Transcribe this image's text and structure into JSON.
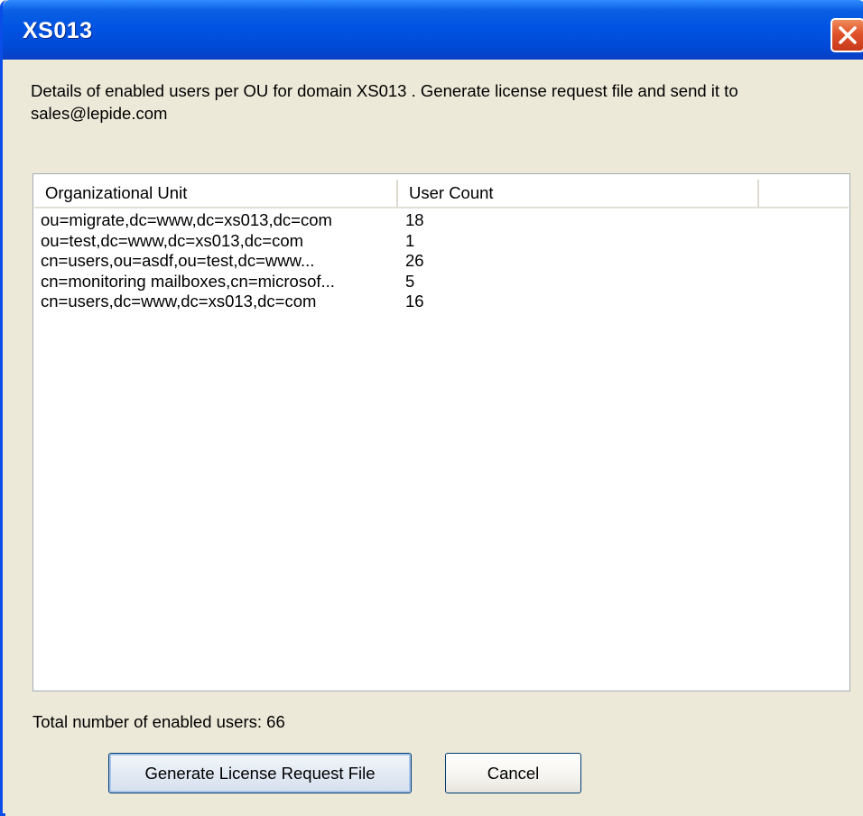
{
  "window": {
    "title": "XS013"
  },
  "description": "Details of enabled users per OU for domain XS013 . Generate license request file and send it to sales@lepide.com",
  "list": {
    "columns": [
      "Organizational Unit",
      "User Count",
      ""
    ],
    "rows": [
      {
        "ou": "ou=migrate,dc=www,dc=xs013,dc=com",
        "count": "18"
      },
      {
        "ou": "ou=test,dc=www,dc=xs013,dc=com",
        "count": "1"
      },
      {
        "ou": "cn=users,ou=asdf,ou=test,dc=www...",
        "count": "26"
      },
      {
        "ou": "cn=monitoring mailboxes,cn=microsof...",
        "count": "5"
      },
      {
        "ou": "cn=users,dc=www,dc=xs013,dc=com",
        "count": "16"
      }
    ]
  },
  "total_label": "Total number of enabled users: 66",
  "buttons": {
    "generate": "Generate License Request File",
    "cancel": "Cancel"
  },
  "colors": {
    "titlebar": "#0054e3",
    "close": "#e0522a",
    "dialog_bg": "#ece9d8"
  },
  "icons": {
    "close": "close-icon"
  }
}
